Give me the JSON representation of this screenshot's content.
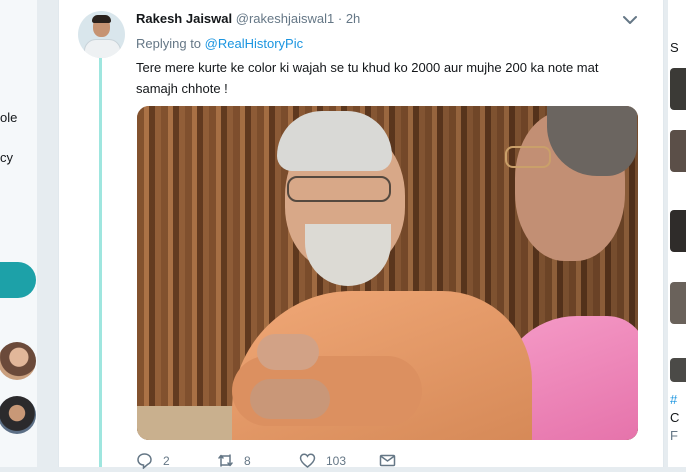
{
  "left_sidebar": {
    "fragment_1": "ole",
    "fragment_2": "cy"
  },
  "tweet": {
    "author_name": "Rakesh Jaiswal",
    "author_handle": "@rakeshjaiswal1",
    "separator": "·",
    "time": "2h",
    "replying_prefix": "Replying to",
    "replying_handle": "@RealHistoryPic",
    "text": "Tere mere kurte ke color ki wajah se tu khud ko 2000 aur mujhe 200 ka note mat samajh chhote !",
    "actions": {
      "replies": "2",
      "retweets": "8",
      "likes": "103"
    }
  },
  "right_sidebar": {
    "fragment_1": "S",
    "fragment_2": "#",
    "fragment_3": "C",
    "fragment_4": "F"
  },
  "colors": {
    "accent": "#1da1f2",
    "link": "#1b95e0",
    "thread_line": "#9fe6df",
    "sidebar_button": "#1da1a8"
  },
  "icons": [
    "chevron-down-icon",
    "reply-icon",
    "retweet-icon",
    "like-icon",
    "message-icon"
  ]
}
